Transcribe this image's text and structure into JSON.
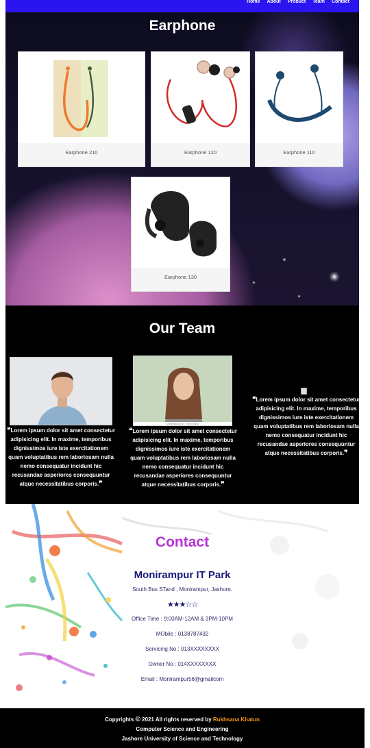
{
  "nav": {
    "items": [
      "Home",
      "About",
      "Product",
      "Team",
      "Contact"
    ]
  },
  "earphone": {
    "title": "Earphone",
    "products": [
      {
        "name": "Earphone 210"
      },
      {
        "name": "Earphone 120"
      },
      {
        "name": "Earphone 110"
      },
      {
        "name": "Earphone 130"
      }
    ]
  },
  "team": {
    "title": "Our Team",
    "members": [
      {
        "quote": "Lorem ipsum dolor sit amet consectetur adipisicing elit. In maxime, temporibus dignissimos iure iste exercitationem quam voluptatibus rem laboriosam nulla nemo consequatur incidunt hic recusandae asperiores consequuntur atque necessitatibus corporis."
      },
      {
        "quote": "Lorem ipsum dolor sit amet consectetur adipisicing elit. In maxime, temporibus dignissimos iure iste exercitationem quam voluptatibus rem laboriosam nulla nemo consequatur incidunt hic recusandae asperiores consequuntur atque necessitatibus corporis.",
        "watermark": "shutterstock.com · 559754608"
      },
      {
        "quote": "Lorem ipsum dolor sit amet consectetur adipisicing elit. In maxime, temporibus dignissimos iure iste exercitationem quam voluptatibus rem laboriosam nulla nemo consequatur incidunt hic recusandae asperiores consequuntur atque necessitatibus corporis."
      }
    ]
  },
  "contact": {
    "title": "Contact",
    "company": "Monirampur IT Park",
    "address": "South Bus STand , Monirampur, Jashore.",
    "rating": 3.5,
    "rating_max": 5,
    "office_time": "Office Time : 9:00AM-12AM & 3PM-10PM",
    "mobile": "MObile : 0138787432",
    "servicing": "Servicing No : 013XXXXXXXX",
    "owner": "Owner No : 014XXXXXXXX",
    "email": "Email : Monirampur56@gmailcom"
  },
  "footer": {
    "copyright_prefix": "Copyrights",
    "copyright_symbol": "©",
    "copyright_text": "2021 All rights reserved by",
    "author": "Rukhsana Khatun",
    "line2": "Computer Science and Engineering",
    "line3": "Jashore University of Science and Technology"
  },
  "colors": {
    "nav_bg": "#2a14f0",
    "contact_title": "#b634d6",
    "author": "#f39a1e"
  }
}
